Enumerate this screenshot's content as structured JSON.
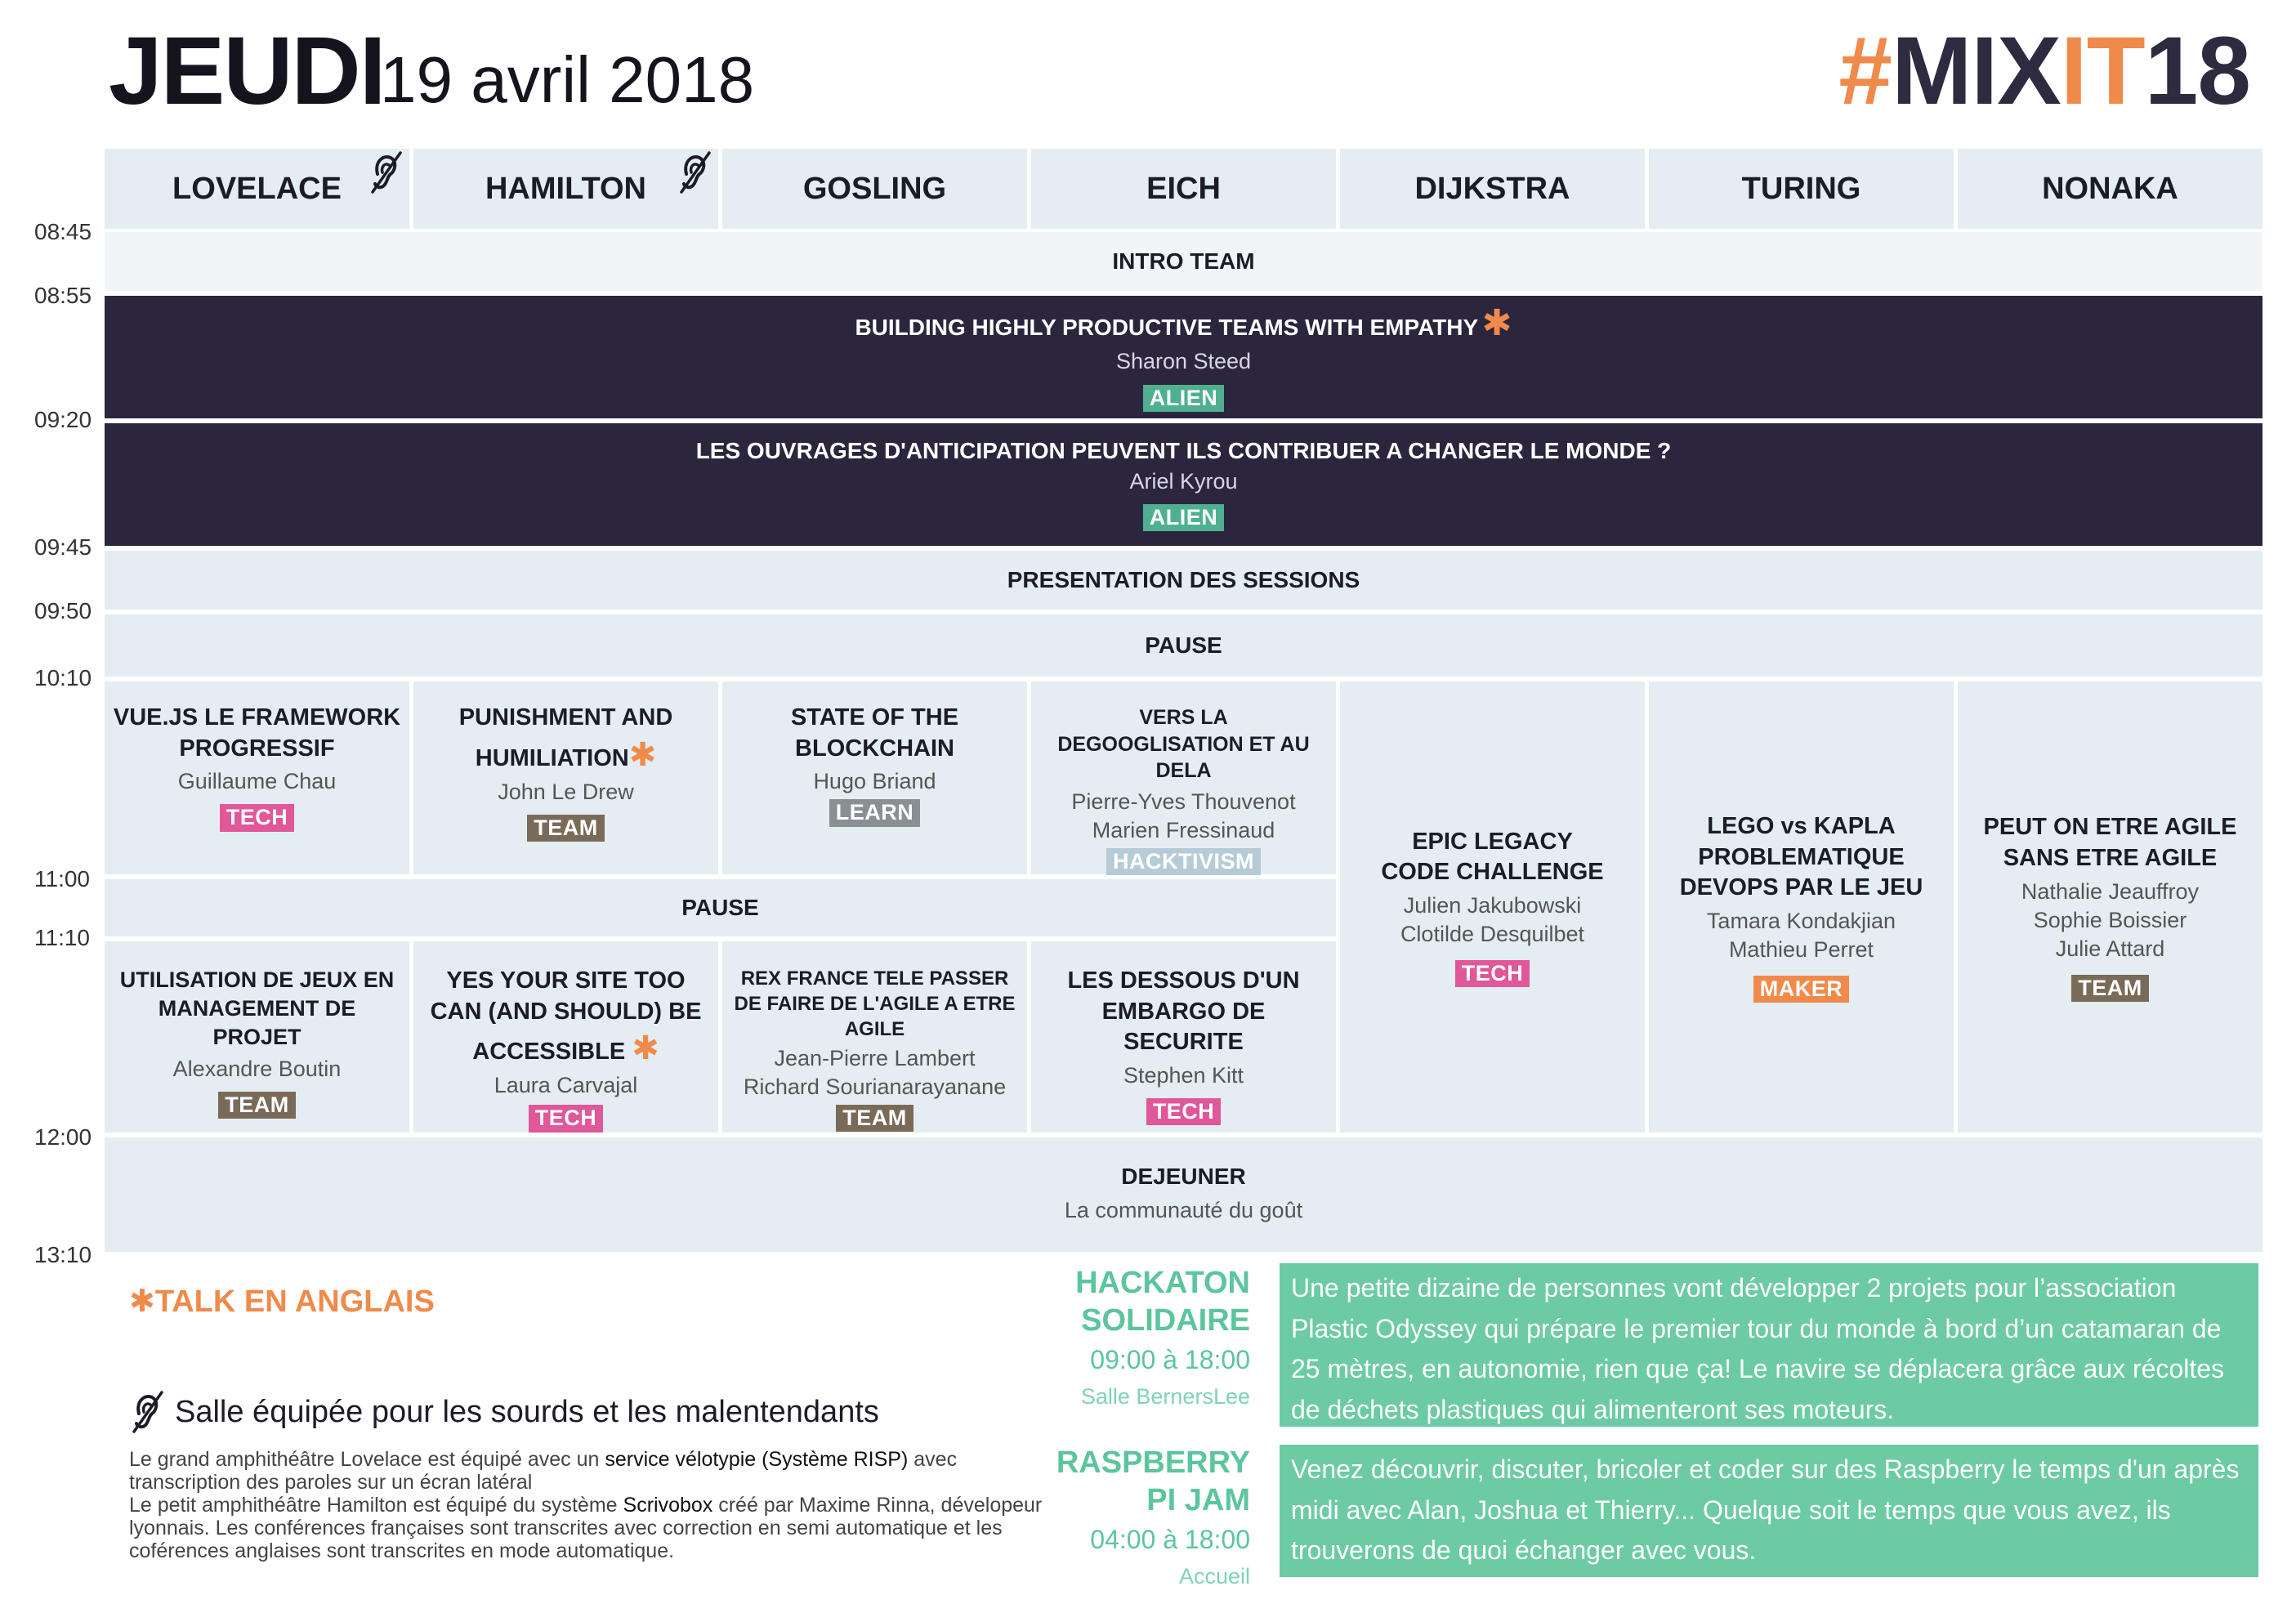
{
  "header": {
    "day": "JEUDI",
    "date": "19 avril 2018",
    "logo": {
      "hash": "#",
      "mix": "MIX",
      "it": "IT",
      "num": "18"
    }
  },
  "times": [
    "08:45",
    "08:55",
    "09:20",
    "09:45",
    "09:50",
    "10:10",
    "11:00",
    "11:10",
    "12:00",
    "13:10"
  ],
  "rooms": [
    "LOVELACE",
    "HAMILTON",
    "GOSLING",
    "EICH",
    "DIJKSTRA",
    "TURING",
    "NONAKA"
  ],
  "plenary": {
    "intro": "INTRO TEAM",
    "keynote1": {
      "title": "BUILDING HIGHLY PRODUCTIVE TEAMS WITH EMPATHY",
      "speaker": "Sharon Steed",
      "tag": "ALIEN"
    },
    "keynote2": {
      "title": "LES OUVRAGES D'ANTICIPATION PEUVENT ILS CONTRIBUER A CHANGER LE MONDE ?",
      "speaker": "Ariel Kyrou",
      "tag": "ALIEN"
    },
    "presentation": "PRESENTATION DES SESSIONS",
    "pause1": "PAUSE",
    "pause2": "PAUSE",
    "lunch": {
      "title": "DEJEUNER",
      "subtitle": "La communauté du goût"
    }
  },
  "slot1": [
    {
      "title": "VUE.JS LE FRAMEWORK PROGRESSIF",
      "speakers": "Guillaume Chau",
      "tag": "TECH"
    },
    {
      "title": "PUNISHMENT AND HUMILIATION",
      "speakers": "John Le Drew",
      "tag": "TEAM"
    },
    {
      "title": "STATE OF THE BLOCKCHAIN",
      "speakers": "Hugo Briand",
      "tag": "LEARN"
    },
    {
      "title": "VERS LA DEGOOGLISATION ET AU DELA",
      "speakers": "Pierre-Yves Thouvenot\nMarien Fressinaud",
      "tag": "HACKTIVISM"
    }
  ],
  "long": [
    {
      "title": "EPIC LEGACY CODE CHALLENGE",
      "speakers": "Julien Jakubowski\nClotilde Desquilbet",
      "tag": "TECH"
    },
    {
      "title": "LEGO vs KAPLA PROBLEMATIQUE DEVOPS PAR LE JEU",
      "speakers": "Tamara Kondakjian\nMathieu Perret",
      "tag": "MAKER"
    },
    {
      "title": "PEUT ON ETRE AGILE SANS ETRE AGILE",
      "speakers": "Nathalie Jeauffroy\nSophie Boissier\nJulie Attard",
      "tag": "TEAM"
    }
  ],
  "slot2": [
    {
      "title": "UTILISATION DE JEUX EN MANAGEMENT DE PROJET",
      "speakers": "Alexandre Boutin",
      "tag": "TEAM"
    },
    {
      "title": "YES YOUR SITE TOO CAN (AND SHOULD) BE ACCESSIBLE",
      "speakers": "Laura Carvajal",
      "tag": "TECH"
    },
    {
      "title": "REX FRANCE TELE PASSER DE FAIRE DE L'AGILE A ETRE AGILE",
      "speakers": "Jean-Pierre Lambert\nRichard Sourianarayanane",
      "tag": "TEAM"
    },
    {
      "title": "LES DESSOUS D'UN EMBARGO DE SECURITE",
      "speakers": "Stephen Kitt",
      "tag": "TECH"
    }
  ],
  "legend": {
    "english": "TALK EN ANGLAIS",
    "deaf": "Salle équipée pour les sourds et les malentendants",
    "line1a": "Le grand amphithéâtre Lovelace est équipé avec un ",
    "line1b": "service vélotypie (Système RISP)",
    "line1c": " avec transcription des paroles sur un écran latéral",
    "line2a": "Le petit amphithéâtre Hamilton est équipé du système ",
    "line2b": "Scrivobox",
    "line2c": " créé par Maxime Rinna, dévelopeur lyonnais. Les conférences françaises sont transcrites avec correction en semi automatique et les coférences anglaises sont transcrites en mode automatique."
  },
  "side": [
    {
      "title1": "HACKATON",
      "title2": "SOLIDAIRE",
      "time": "09:00 à 18:00",
      "place": "Salle BernersLee",
      "text": "Une petite dizaine de personnes vont développer 2 projets pour l’association Plastic Odyssey qui prépare le premier tour du monde à bord d’un catamaran de 25 mètres, en autonomie, rien que ça! Le navire se déplacera grâce aux récoltes de déchets plastiques qui alimenteront ses moteurs."
    },
    {
      "title1": "RASPBERRY",
      "title2": "PI JAM",
      "time": "04:00 à 18:00",
      "place": "Accueil",
      "text": "Venez découvrir, discuter, bricoler et coder sur des Raspberry le temps d'un après midi avec Alan, Joshua et Thierry... Quelque soit le temps que vous avez, ils trouverons de quoi échanger avec vous."
    }
  ],
  "colors": {
    "dark": "#2b263d",
    "orange": "#f08a4b",
    "green": "#6ccba3",
    "cell": "#e4edf1"
  }
}
